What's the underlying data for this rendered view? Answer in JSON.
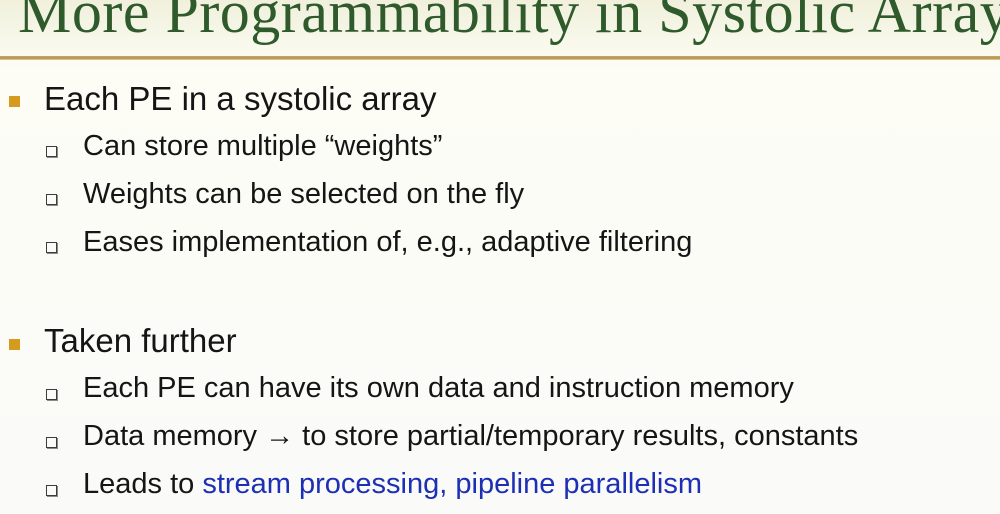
{
  "slide": {
    "title": "More Programmability in Systolic Arrays",
    "bullets": [
      {
        "text": "Each PE in a systolic array",
        "subitems": [
          {
            "prefix": "Can store multiple “weights”",
            "link": ""
          },
          {
            "prefix": "Weights can be selected on the fly",
            "link": ""
          },
          {
            "prefix": "Eases implementation of, e.g., adaptive filtering",
            "link": ""
          }
        ]
      },
      {
        "text": "Taken further",
        "subitems": [
          {
            "prefix": "Each PE can have its own data and instruction memory",
            "link": ""
          },
          {
            "prefix": "Data memory → to store partial/temporary results, constants",
            "link": ""
          },
          {
            "prefix": "Leads to ",
            "link": "stream processing, pipeline parallelism"
          }
        ]
      }
    ],
    "colors": {
      "title": "#2f5a2c",
      "rule": "#b8924f",
      "level1_marker": "#d49b1e",
      "link": "#1d2fb5",
      "text": "#151515"
    }
  }
}
